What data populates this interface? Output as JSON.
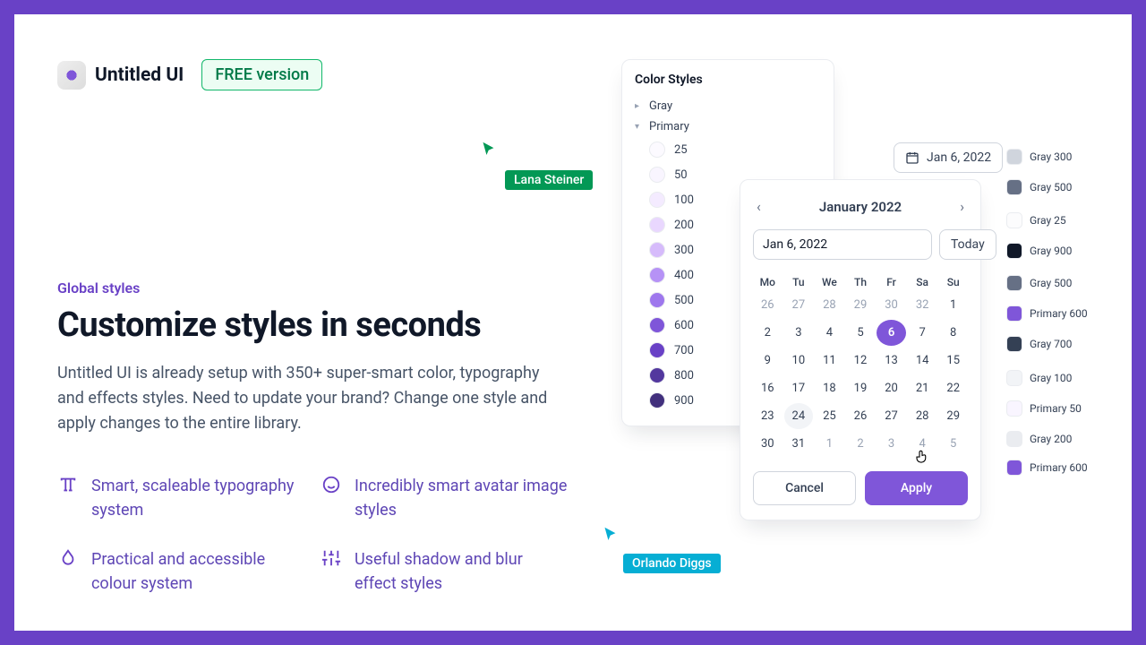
{
  "header": {
    "brand": "Untitled UI",
    "badge": "FREE version"
  },
  "content": {
    "eyebrow": "Global styles",
    "title": "Customize styles in seconds",
    "description": "Untitled UI is already setup with 350+ super-smart color, typography and effects styles. Need to update your brand? Change one style and apply changes to the entire library.",
    "features": [
      "Smart, scaleable typography system",
      "Incredibly smart avatar image styles",
      "Practical and accessible colour system",
      "Useful shadow and blur effect styles"
    ]
  },
  "colorStyles": {
    "title": "Color Styles",
    "groups": [
      "Gray",
      "Primary"
    ],
    "primary": [
      {
        "label": "25",
        "hex": "#FCFAFF"
      },
      {
        "label": "50",
        "hex": "#F9F5FF"
      },
      {
        "label": "100",
        "hex": "#F4EBFF"
      },
      {
        "label": "200",
        "hex": "#E9D7FE"
      },
      {
        "label": "300",
        "hex": "#D6BBFB"
      },
      {
        "label": "400",
        "hex": "#B692F6"
      },
      {
        "label": "500",
        "hex": "#9E77ED"
      },
      {
        "label": "600",
        "hex": "#7F56D9"
      },
      {
        "label": "700",
        "hex": "#6941C6"
      },
      {
        "label": "800",
        "hex": "#53389E"
      },
      {
        "label": "900",
        "hex": "#42307D"
      }
    ]
  },
  "calendar": {
    "month": "January 2022",
    "selectedDate": "Jan 6, 2022",
    "todayLabel": "Today",
    "cancel": "Cancel",
    "apply": "Apply",
    "dow": [
      "Mo",
      "Tu",
      "We",
      "Th",
      "Fr",
      "Sa",
      "Su"
    ],
    "days": [
      {
        "n": 26,
        "muted": true
      },
      {
        "n": 27,
        "muted": true
      },
      {
        "n": 28,
        "muted": true
      },
      {
        "n": 29,
        "muted": true
      },
      {
        "n": 30,
        "muted": true
      },
      {
        "n": 32,
        "muted": true
      },
      {
        "n": 1
      },
      {
        "n": 2
      },
      {
        "n": 3
      },
      {
        "n": 4
      },
      {
        "n": 5
      },
      {
        "n": 6,
        "sel": true
      },
      {
        "n": 7
      },
      {
        "n": 8
      },
      {
        "n": 9
      },
      {
        "n": 10
      },
      {
        "n": 11
      },
      {
        "n": 12
      },
      {
        "n": 13
      },
      {
        "n": 14
      },
      {
        "n": 15
      },
      {
        "n": 16
      },
      {
        "n": 17
      },
      {
        "n": 18
      },
      {
        "n": 19
      },
      {
        "n": 20
      },
      {
        "n": 21
      },
      {
        "n": 22
      },
      {
        "n": 23
      },
      {
        "n": 24,
        "hov": true
      },
      {
        "n": 25
      },
      {
        "n": 26
      },
      {
        "n": 27
      },
      {
        "n": 28
      },
      {
        "n": 29
      },
      {
        "n": 30
      },
      {
        "n": 31
      },
      {
        "n": 1,
        "muted": true
      },
      {
        "n": 2,
        "muted": true
      },
      {
        "n": 3,
        "muted": true
      },
      {
        "n": 4,
        "muted": true
      },
      {
        "n": 5,
        "muted": true
      }
    ]
  },
  "annotations": [
    {
      "label": "Gray 300",
      "hex": "#D0D5DD"
    },
    {
      "label": "Gray 500",
      "hex": "#667085"
    },
    {
      "label": "Gray 25",
      "hex": "#FCFCFD"
    },
    {
      "label": "Gray 900",
      "hex": "#101828"
    },
    {
      "label": "Gray 500",
      "hex": "#667085"
    },
    {
      "label": "Primary 600",
      "hex": "#7F56D9"
    },
    {
      "label": "Gray 700",
      "hex": "#344054"
    },
    {
      "label": "Gray 100",
      "hex": "#F2F4F7"
    },
    {
      "label": "Primary 50",
      "hex": "#F9F5FF"
    },
    {
      "label": "Gray 200",
      "hex": "#EAECF0"
    },
    {
      "label": "Primary 600",
      "hex": "#7F56D9"
    }
  ],
  "annotationGaps": [
    22,
    35,
    18,
    34,
    20,
    20,
    36,
    28,
    32,
    14
  ],
  "cursors": [
    {
      "name": "Lana Steiner"
    },
    {
      "name": "Orlando Diggs"
    }
  ]
}
